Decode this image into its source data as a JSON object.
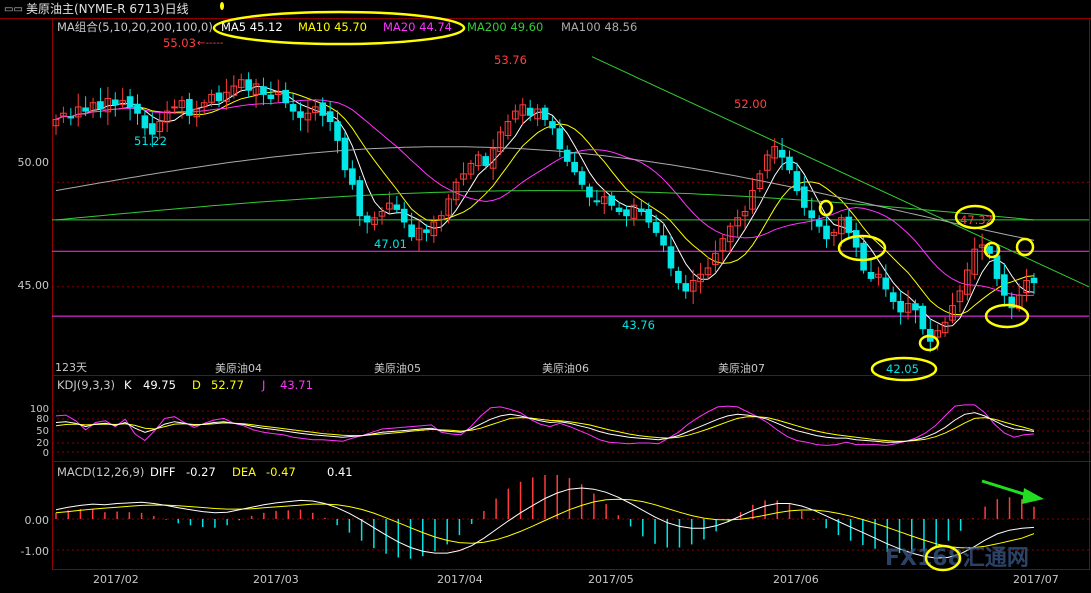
{
  "window": {
    "title": "美原油主(NYME-R 6713)日线",
    "period_days": "123天"
  },
  "colors": {
    "background": "#000000",
    "frame": "#8b0000",
    "bull_candle": "#ff3b3b",
    "bear_candle": "#00e5e5",
    "ma5": "#ffffff",
    "ma10": "#ffff00",
    "ma20": "#ff33ff",
    "ma200": "#33cc33",
    "ma100": "#aaaaaa",
    "annotation": "#ffff00"
  },
  "main_panel": {
    "legend": {
      "label": "MA组合(5,10,20,200,100,0)",
      "ma5": "MA5 45.12",
      "ma10": "MA10 45.70",
      "ma20": "MA20 44.74",
      "ma200": "MA200 49.60",
      "ma100": "MA100 48.56"
    },
    "y_ticks": [
      "50.00",
      "45.00"
    ],
    "price_labels": {
      "p1": "55.03",
      "p2": "51.22",
      "p3": "53.76",
      "p4": "47.01",
      "p5": "52.00",
      "p6": "43.76",
      "p7": "47.32",
      "p8": "42.05"
    },
    "contract_labels": [
      "美原油04",
      "美原油05",
      "美原油06",
      "美原油07"
    ]
  },
  "kdj_panel": {
    "label": "KDJ(9,3,3)",
    "k_label": "K",
    "k_value": "49.75",
    "d_label": "D",
    "d_value": "52.77",
    "j_label": "J",
    "j_value": "43.71",
    "y_ticks": [
      "100",
      "80",
      "50",
      "20",
      "0"
    ]
  },
  "macd_panel": {
    "label": "MACD(12,26,9)",
    "diff_label": "DIFF",
    "diff_value": "-0.27",
    "dea_label": "DEA",
    "dea_value": "-0.47",
    "macd_value": "0.41",
    "y_ticks": [
      "0.00",
      "-1.00"
    ]
  },
  "x_axis": {
    "labels": [
      "2017/02",
      "2017/03",
      "2017/04",
      "2017/05",
      "2017/06",
      "2017/07"
    ]
  },
  "watermark": "FX168汇通网",
  "chart_data": {
    "type": "candlestick",
    "instrument": "美原油主(NYME-R 6713)日线",
    "ylim": [
      41.5,
      56.8
    ],
    "annotated_prices": [
      55.03,
      51.22,
      53.76,
      47.01,
      52.0,
      43.76,
      47.32,
      42.05
    ],
    "ma_last": {
      "MA5": 45.12,
      "MA10": 45.7,
      "MA20": 44.74,
      "MA200": 49.6,
      "MA100": 48.56
    },
    "kdj_last": {
      "K": 49.75,
      "D": 52.77,
      "J": 43.71
    },
    "macd_last": {
      "DIFF": -0.27,
      "DEA": -0.47,
      "MACD": 0.41
    },
    "close_path": [
      53.0,
      53.3,
      53.1,
      53.6,
      53.4,
      53.8,
      53.5,
      54.0,
      53.7,
      53.9,
      53.6,
      53.3,
      52.6,
      52.3,
      52.9,
      53.4,
      53.6,
      53.9,
      53.2,
      53.5,
      53.8,
      54.2,
      53.9,
      54.3,
      54.6,
      54.9,
      54.4,
      54.7,
      54.2,
      54.0,
      54.3,
      53.8,
      53.4,
      53.1,
      53.3,
      53.6,
      53.2,
      52.9,
      52.0,
      50.6,
      49.9,
      48.4,
      48.1,
      48.3,
      48.6,
      49.0,
      48.7,
      48.1,
      47.4,
      47.8,
      47.6,
      48.1,
      48.4,
      49.2,
      50.0,
      50.4,
      50.9,
      51.3,
      50.8,
      51.6,
      52.4,
      52.9,
      53.4,
      53.7,
      53.2,
      53.5,
      53.0,
      52.6,
      51.6,
      51.0,
      50.5,
      49.9,
      49.3,
      49.1,
      49.3,
      48.9,
      48.6,
      48.4,
      48.9,
      48.6,
      48.1,
      47.6,
      47.0,
      45.9,
      45.2,
      44.8,
      45.3,
      45.6,
      45.9,
      46.6,
      47.3,
      47.9,
      48.3,
      48.6,
      49.6,
      50.4,
      51.3,
      51.7,
      51.2,
      50.6,
      49.6,
      48.8,
      48.3,
      47.9,
      47.3,
      47.6,
      48.3,
      47.6,
      46.9,
      45.8,
      45.4,
      45.6,
      44.9,
      44.3,
      43.8,
      44.2,
      43.9,
      43.0,
      42.4,
      42.9,
      43.3,
      44.1,
      44.8,
      45.8,
      46.8,
      47.0,
      46.6,
      45.4,
      44.6,
      44.0,
      44.6,
      45.3,
      45.2
    ],
    "kdj_k_path": [
      72,
      74,
      70,
      62,
      68,
      70,
      65,
      72,
      58,
      48,
      55,
      68,
      74,
      70,
      65,
      68,
      72,
      74,
      70,
      67,
      62,
      58,
      55,
      52,
      48,
      45,
      42,
      40,
      38,
      36,
      38,
      40,
      44,
      48,
      50,
      52,
      54,
      56,
      58,
      52,
      50,
      48,
      56,
      68,
      80,
      88,
      92,
      88,
      82,
      76,
      72,
      74,
      70,
      64,
      58,
      50,
      44,
      40,
      36,
      34,
      32,
      30,
      34,
      40,
      50,
      60,
      70,
      80,
      88,
      92,
      90,
      86,
      80,
      70,
      60,
      52,
      46,
      40,
      36,
      34,
      34,
      30,
      28,
      26,
      24,
      24,
      26,
      30,
      36,
      46,
      60,
      78,
      92,
      96,
      88,
      76,
      64,
      56,
      54,
      50
    ],
    "kdj_d_path": [
      64,
      67,
      68,
      66,
      67,
      68,
      67,
      69,
      65,
      58,
      56,
      62,
      68,
      69,
      67,
      67,
      69,
      71,
      70,
      69,
      66,
      63,
      60,
      57,
      54,
      51,
      48,
      45,
      43,
      41,
      40,
      40,
      42,
      44,
      46,
      48,
      51,
      53,
      55,
      54,
      53,
      51,
      53,
      58,
      66,
      74,
      82,
      84,
      83,
      80,
      77,
      76,
      74,
      70,
      66,
      60,
      54,
      49,
      44,
      40,
      37,
      35,
      34,
      36,
      41,
      48,
      56,
      65,
      74,
      82,
      86,
      86,
      84,
      78,
      71,
      64,
      57,
      51,
      46,
      42,
      39,
      36,
      33,
      30,
      28,
      26,
      26,
      28,
      31,
      37,
      46,
      58,
      71,
      82,
      84,
      80,
      73,
      66,
      60,
      53
    ],
    "kdj_j_path": [
      88,
      90,
      76,
      54,
      72,
      76,
      62,
      80,
      44,
      28,
      52,
      82,
      86,
      72,
      60,
      70,
      78,
      82,
      70,
      64,
      54,
      48,
      45,
      42,
      36,
      33,
      30,
      30,
      28,
      26,
      34,
      40,
      48,
      56,
      58,
      60,
      62,
      64,
      66,
      48,
      44,
      42,
      62,
      88,
      108,
      110,
      104,
      96,
      80,
      68,
      62,
      70,
      62,
      52,
      42,
      30,
      24,
      22,
      20,
      22,
      22,
      20,
      34,
      48,
      68,
      84,
      98,
      110,
      112,
      110,
      98,
      86,
      72,
      54,
      38,
      28,
      24,
      18,
      16,
      18,
      24,
      18,
      18,
      18,
      16,
      20,
      26,
      34,
      46,
      64,
      88,
      112,
      120,
      118,
      96,
      68,
      46,
      36,
      42,
      44
    ],
    "macd_diff_path": [
      0.3,
      0.38,
      0.44,
      0.48,
      0.46,
      0.5,
      0.52,
      0.54,
      0.5,
      0.44,
      0.36,
      0.3,
      0.24,
      0.2,
      0.22,
      0.3,
      0.38,
      0.46,
      0.52,
      0.56,
      0.6,
      0.58,
      0.5,
      0.36,
      0.18,
      -0.04,
      -0.28,
      -0.52,
      -0.74,
      -0.92,
      -1.04,
      -1.1,
      -1.1,
      -1.02,
      -0.86,
      -0.62,
      -0.34,
      -0.06,
      0.2,
      0.44,
      0.66,
      0.84,
      0.96,
      1.0,
      0.96,
      0.86,
      0.7,
      0.5,
      0.28,
      0.06,
      -0.12,
      -0.24,
      -0.3,
      -0.3,
      -0.22,
      -0.08,
      0.1,
      0.28,
      0.42,
      0.5,
      0.5,
      0.42,
      0.28,
      0.1,
      -0.08,
      -0.26,
      -0.44,
      -0.62,
      -0.8,
      -0.96,
      -1.1,
      -1.2,
      -1.26,
      -1.24,
      -1.12,
      -0.92,
      -0.68,
      -0.48,
      -0.36,
      -0.3,
      -0.27
    ],
    "macd_dea_path": [
      0.2,
      0.24,
      0.28,
      0.32,
      0.35,
      0.38,
      0.41,
      0.44,
      0.45,
      0.45,
      0.43,
      0.4,
      0.37,
      0.34,
      0.32,
      0.32,
      0.33,
      0.36,
      0.39,
      0.42,
      0.45,
      0.48,
      0.48,
      0.46,
      0.4,
      0.31,
      0.19,
      0.04,
      -0.12,
      -0.28,
      -0.44,
      -0.58,
      -0.69,
      -0.76,
      -0.78,
      -0.75,
      -0.67,
      -0.55,
      -0.4,
      -0.23,
      -0.05,
      0.13,
      0.3,
      0.44,
      0.55,
      0.62,
      0.64,
      0.62,
      0.56,
      0.46,
      0.34,
      0.22,
      0.11,
      0.03,
      -0.02,
      -0.03,
      -0.01,
      0.05,
      0.12,
      0.2,
      0.26,
      0.29,
      0.29,
      0.25,
      0.18,
      0.09,
      -0.02,
      -0.14,
      -0.27,
      -0.41,
      -0.55,
      -0.68,
      -0.8,
      -0.89,
      -0.93,
      -0.93,
      -0.88,
      -0.8,
      -0.71,
      -0.62,
      -0.47
    ]
  }
}
